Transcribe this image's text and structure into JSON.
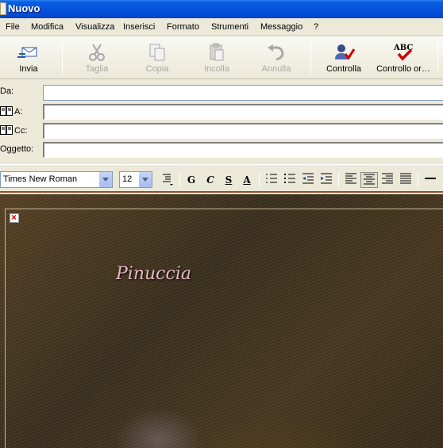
{
  "window": {
    "title": "Nuovo"
  },
  "menu": [
    "File",
    "Modifica",
    "Visualizza",
    "Inserisci",
    "Formato",
    "Strumenti",
    "Messaggio",
    "?"
  ],
  "toolbar": {
    "send": "Invia",
    "cut": "Taglia",
    "copy": "Copia",
    "paste": "Incolla",
    "undo": "Annulla",
    "check": "Controlla",
    "spelling": "Controllo or…"
  },
  "header": {
    "from_label": "Da:",
    "to_label": "A:",
    "cc_label": "Cc:",
    "subject_label": "Oggetto:",
    "from_value": "",
    "to_value": "",
    "cc_value": "",
    "subject_value": ""
  },
  "format": {
    "font": "Times New Roman",
    "size": "12",
    "bold": "G",
    "italic": "C",
    "underline": "S",
    "font_color": "A"
  },
  "body": {
    "signature": "Pinuccia"
  },
  "colors": {
    "titlebar": "#0553dc",
    "accent_red": "#d00000"
  }
}
